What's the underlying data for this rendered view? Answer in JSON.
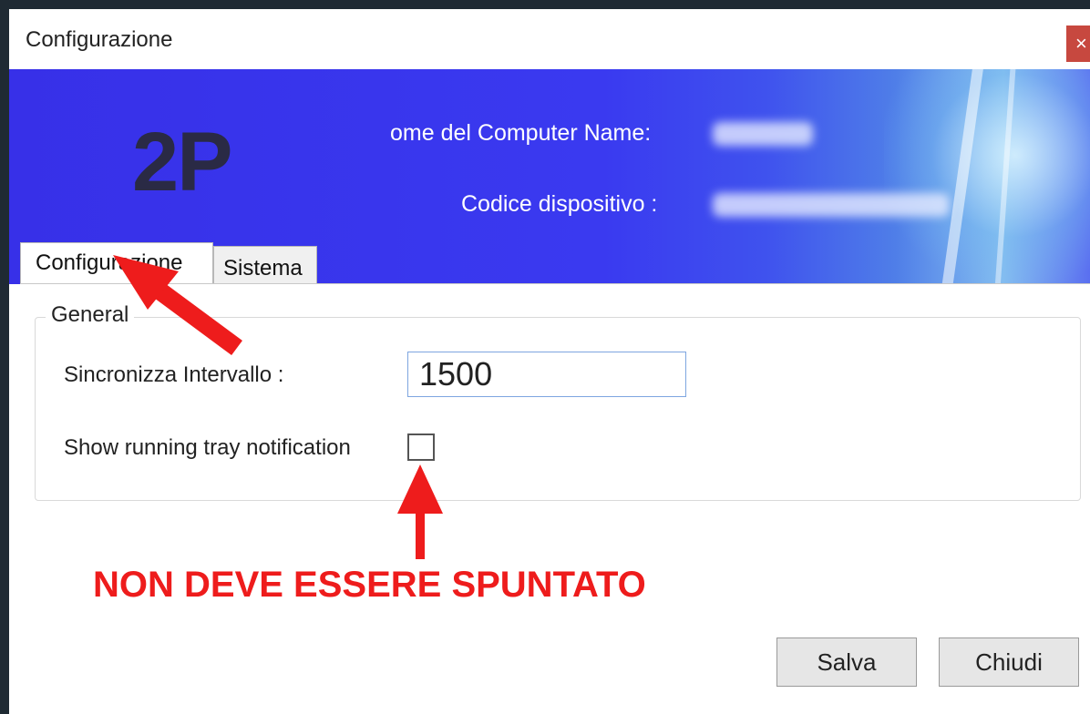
{
  "window": {
    "title": "Configurazione",
    "close_label": "×"
  },
  "banner": {
    "logo_text": "2P",
    "computer_name_label": "ome del Computer Name:",
    "device_code_label": "Codice dispositivo :"
  },
  "tabs": [
    {
      "label": "Configurazione",
      "active": true
    },
    {
      "label": "Sistema",
      "active": false
    }
  ],
  "general_group": {
    "legend": "General",
    "sync_interval_label": "Sincronizza Intervallo :",
    "sync_interval_value": "1500",
    "tray_notification_label": "Show running tray notification",
    "tray_notification_checked": false
  },
  "annotation": {
    "warning_text": "NON DEVE ESSERE SPUNTATO",
    "arrow_color": "#ee1c1c"
  },
  "buttons": {
    "save_label": "Salva",
    "close_label": "Chiudi"
  }
}
